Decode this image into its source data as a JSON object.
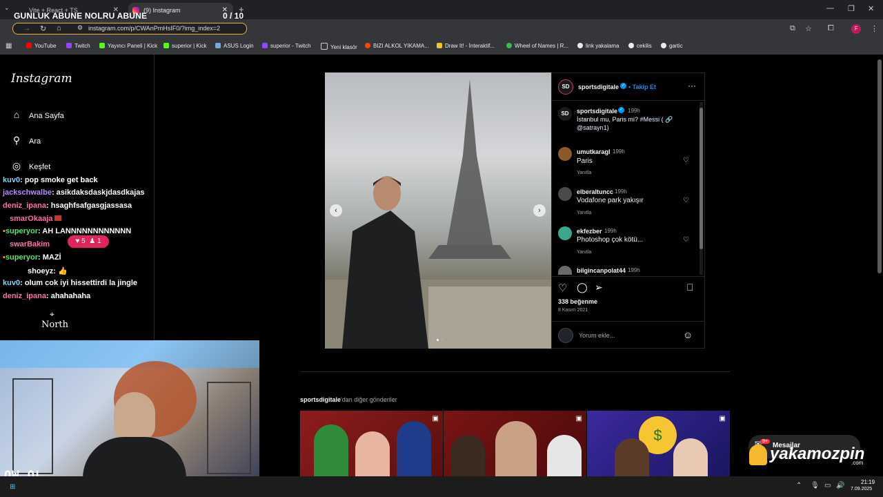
{
  "overlay": {
    "title": "GUNLUK ABUNE NOLRU ABUNE",
    "count": "0  / 10"
  },
  "browser": {
    "tabs": [
      {
        "label": "Vite + React + TS"
      },
      {
        "label": "(9) Instagram"
      }
    ],
    "url": "instagram.com/p/CWAnPmHsIF0/?img_index=2",
    "bookmarks": [
      "YouTube",
      "Twitch",
      "Yayıncı Paneli | Kick",
      "superior | Kick",
      "ASUS Login",
      "superior - Twitch",
      "Yeni klasör",
      "BIZI ALKOL YIKAMA...",
      "Draw It! - İnteraktif...",
      "Wheel of Names | R...",
      "link yakalama",
      "cekilis",
      "gartic"
    ]
  },
  "sidebar": {
    "logo": "Instagram",
    "items": [
      {
        "label": "Ana Sayfa",
        "icon": "home-icon"
      },
      {
        "label": "Ara",
        "icon": "search-icon"
      },
      {
        "label": "Keşfet",
        "icon": "compass-icon"
      }
    ]
  },
  "chat": {
    "messages": [
      {
        "user": "kuv0",
        "text": "pop smoke get back",
        "color": "#7fd7ff"
      },
      {
        "user": "jackschwalbe",
        "text": "asikdaksdaskjdasdkajas",
        "color": "#b48cff"
      },
      {
        "user": "deniz_ipana",
        "text": "hsaghfsafgasgjassasa",
        "color": "#ff6fa8"
      },
      {
        "user": "smarOkaaja",
        "text": "",
        "color": "#ff6fa8"
      },
      {
        "user": "superyor",
        "text": "AH LANNNNNNNNNNNN",
        "color": "#59e36b"
      },
      {
        "user": "swarBakim",
        "text": "",
        "color": "#ff6fa8"
      },
      {
        "user": "superyor",
        "text": "MAZİ",
        "color": "#59e36b"
      },
      {
        "user": "shoeyz",
        "text": "",
        "color": "#ffffff"
      },
      {
        "user": "kuv0",
        "text": "olum cok iyi hissettirdi la jingle",
        "color": "#7fd7ff"
      },
      {
        "user": "deniz_ipana",
        "text": "ahahahaha",
        "color": "#ff6fa8"
      }
    ],
    "notif": {
      "likes": "5",
      "followers": "1"
    },
    "north": "North",
    "webcam_label": "OW OL"
  },
  "post": {
    "user": "sportsdigitale",
    "follow": "Takip Et",
    "caption_user": "sportsdigitale",
    "caption_time": "199h",
    "caption_text": "İstanbul mu, Paris mi?",
    "caption_tag": "#Messi",
    "caption_paren": "( 🔗",
    "caption_mention": "@satrayn1",
    "caption_close": ")",
    "comments": [
      {
        "user": "umutkaragl",
        "time": "199h",
        "text": "Paris",
        "reply": "Yanıtla"
      },
      {
        "user": "elberaltuncc",
        "time": "199h",
        "text": "Vodafone park yakışır",
        "reply": "Yanıtla"
      },
      {
        "user": "ekfezber",
        "time": "199h",
        "text": "Photoshop çok kötü...",
        "reply": "Yanıtla"
      },
      {
        "user": "bilgincanpolat44",
        "time": "199h",
        "text": "",
        "reply": ""
      }
    ],
    "likes": "338 beğenme",
    "date": "8 Kasım 2021",
    "comment_placeholder": "Yorum ekle..."
  },
  "more_posts": {
    "user": "sportsdigitale",
    "suffix": "'dan diğer gönderiler"
  },
  "messages_widget": {
    "label": "Mesajlar",
    "badge": "9+"
  },
  "brand": {
    "name": "yakamozpin",
    "suffix": ".com"
  },
  "clock": {
    "time": "21:19",
    "date": "7.09.2025"
  },
  "colors": {
    "accent": "#0095f6",
    "instagram_bg": "#000000",
    "like_red": "#ed4956"
  }
}
